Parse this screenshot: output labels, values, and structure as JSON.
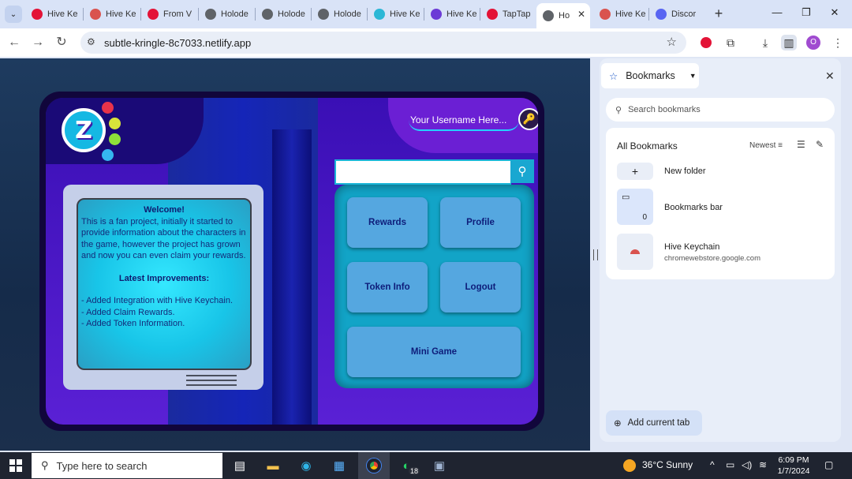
{
  "tabs": [
    {
      "label": "Hive Ke",
      "favicon_color": "#e31337"
    },
    {
      "label": "Hive Ke",
      "favicon_color": "#d9534f"
    },
    {
      "label": "From V",
      "favicon_color": "#e31337"
    },
    {
      "label": "Holode",
      "favicon_color": "#5f6368"
    },
    {
      "label": "Holode",
      "favicon_color": "#5f6368"
    },
    {
      "label": "Holode",
      "favicon_color": "#5f6368"
    },
    {
      "label": "Hive Ke",
      "favicon_color": "#2bb7d6"
    },
    {
      "label": "Hive Ke",
      "favicon_color": "#6c3bd6"
    },
    {
      "label": "TapTap",
      "favicon_color": "#e31337"
    },
    {
      "label": "Ho",
      "favicon_color": "#5f6368",
      "active": true
    },
    {
      "label": "Hive Ke",
      "favicon_color": "#d9534f"
    },
    {
      "label": "Discor",
      "favicon_color": "#5865f2"
    }
  ],
  "address": {
    "url": "subtle-kringle-8c7033.netlify.app"
  },
  "profile_initial": "O",
  "page": {
    "username_placeholder": "Your Username Here...",
    "logo_letter": "Z",
    "welcome_title": "Welcome!",
    "welcome_body": "This is a fan project, initially it started to provide information about the characters in the game, however the project has grown and now you can even claim your rewards.",
    "improvements_title": "Latest Improvements:",
    "improvements": [
      "- Added Integration with Hive Keychain.",
      "- Added Claim Rewards.",
      "- Added Token Information."
    ],
    "buttons": {
      "rewards": "Rewards",
      "profile": "Profile",
      "token_info": "Token Info",
      "logout": "Logout",
      "mini_game": "Mini Game"
    }
  },
  "bookmarks": {
    "header": "Bookmarks",
    "search_placeholder": "Search bookmarks",
    "section_title": "All Bookmarks",
    "sort_label": "Newest",
    "new_folder": "New folder",
    "bar_label": "Bookmarks bar",
    "bar_count": "0",
    "item_title": "Hive Keychain",
    "item_url": "chromewebstore.google.com",
    "add_current_tab": "Add current tab"
  },
  "taskbar": {
    "search_placeholder": "Type here to search",
    "whatsapp_badge": "18",
    "weather": "36°C  Sunny",
    "time": "6:09 PM",
    "date": "1/7/2024"
  }
}
